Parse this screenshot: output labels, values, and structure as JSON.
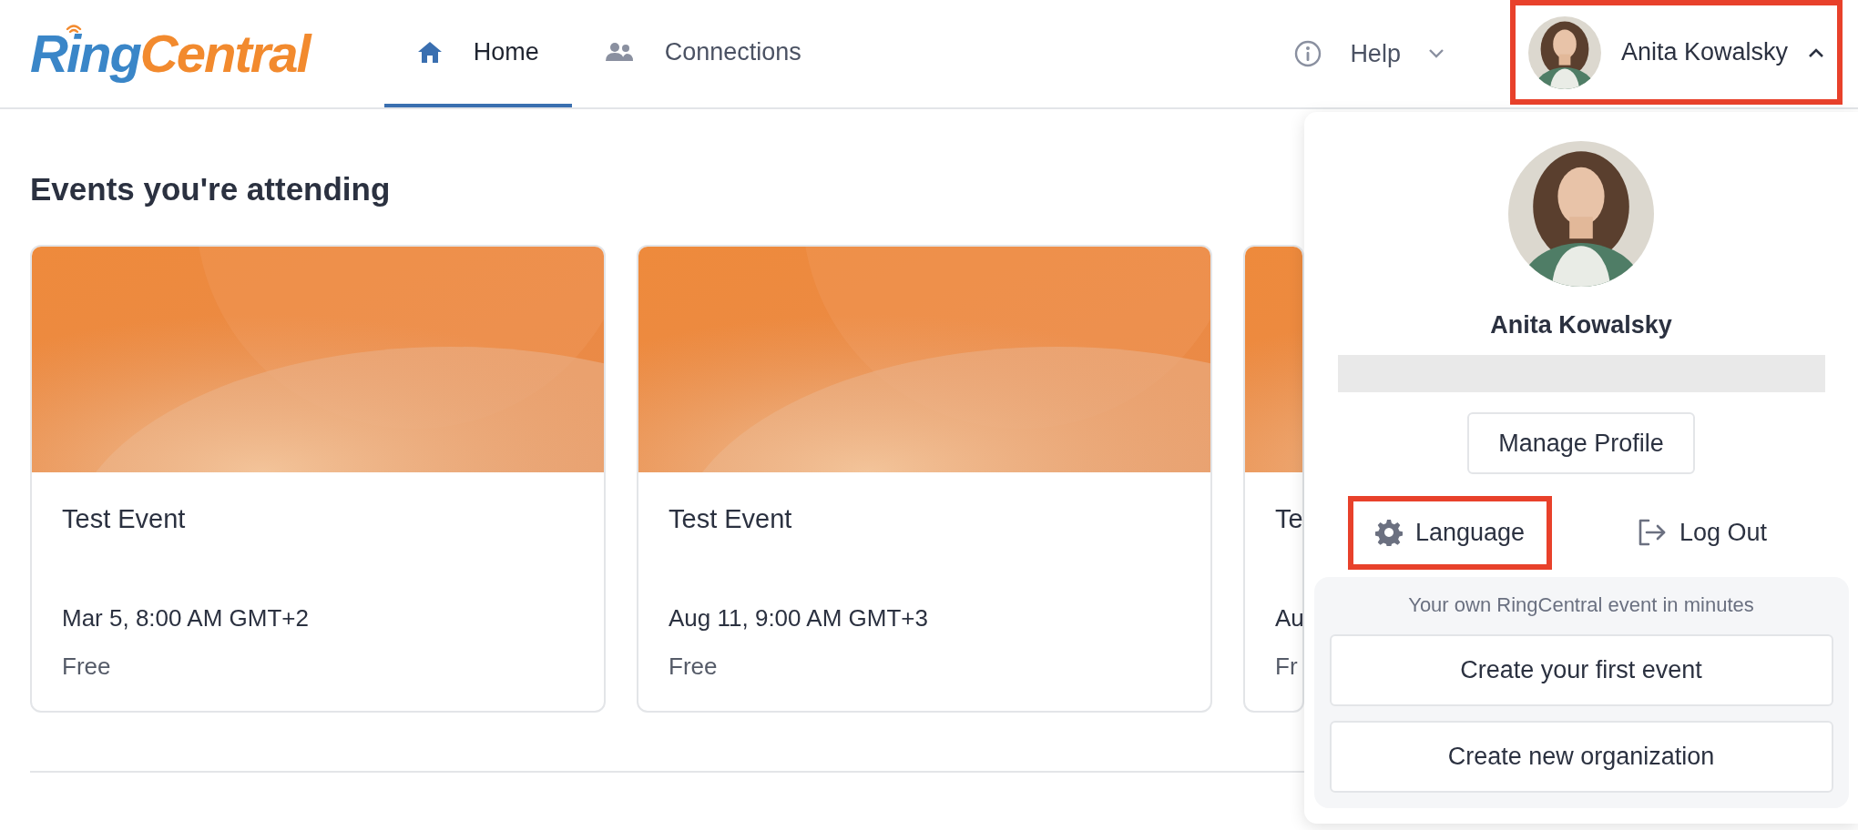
{
  "header": {
    "logo": {
      "part_1": "Ring",
      "part_2": "Central"
    },
    "nav_tabs": [
      {
        "label": "Home",
        "selected": true
      },
      {
        "label": "Connections",
        "selected": false
      }
    ],
    "help": {
      "label": "Help"
    },
    "user_menu": {
      "name": "Anita Kowalsky",
      "expanded": true,
      "highlighted": true
    }
  },
  "main": {
    "title": "Events you're attending",
    "events": [
      {
        "title": "Test Event",
        "date": "Mar 5, 8:00 AM GMT+2",
        "price": "Free"
      },
      {
        "title": "Test Event",
        "date": "Aug 11, 9:00 AM GMT+3",
        "price": "Free"
      },
      {
        "title": "Te",
        "date": "Au",
        "price": "Fr"
      }
    ]
  },
  "profile_menu": {
    "name": "Anita Kowalsky",
    "manage_button": "Manage Profile",
    "actions": [
      {
        "kind": "language",
        "label": "Language",
        "highlighted": true
      },
      {
        "kind": "logout",
        "label": "Log Out",
        "highlighted": false
      }
    ],
    "promo": {
      "text": "Your own RingCentral event in minutes",
      "buttons": [
        "Create your first event",
        "Create new organization"
      ]
    }
  }
}
